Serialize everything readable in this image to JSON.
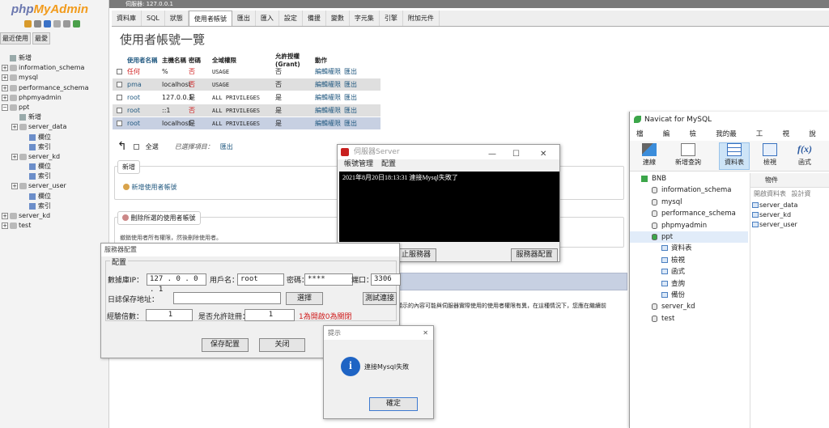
{
  "pma": {
    "logo_a": "php",
    "logo_b": "MyAdmin",
    "nav_tabs": [
      "最近使用",
      "最愛"
    ],
    "tree": [
      {
        "label": "新增",
        "level": 0,
        "kind": "new"
      },
      {
        "label": "information_schema",
        "level": 0,
        "kind": "db"
      },
      {
        "label": "mysql",
        "level": 0,
        "kind": "db"
      },
      {
        "label": "performance_schema",
        "level": 0,
        "kind": "db"
      },
      {
        "label": "phpmyadmin",
        "level": 0,
        "kind": "db"
      },
      {
        "label": "ppt",
        "level": 0,
        "kind": "db-open"
      },
      {
        "label": "新增",
        "level": 1,
        "kind": "new"
      },
      {
        "label": "server_data",
        "level": 1,
        "kind": "table"
      },
      {
        "label": "欄位",
        "level": 2,
        "kind": "sub"
      },
      {
        "label": "索引",
        "level": 2,
        "kind": "sub"
      },
      {
        "label": "server_kd",
        "level": 1,
        "kind": "table"
      },
      {
        "label": "欄位",
        "level": 2,
        "kind": "sub"
      },
      {
        "label": "索引",
        "level": 2,
        "kind": "sub"
      },
      {
        "label": "server_user",
        "level": 1,
        "kind": "table"
      },
      {
        "label": "欄位",
        "level": 2,
        "kind": "sub"
      },
      {
        "label": "索引",
        "level": 2,
        "kind": "sub"
      },
      {
        "label": "server_kd",
        "level": 0,
        "kind": "db"
      },
      {
        "label": "test",
        "level": 0,
        "kind": "db"
      }
    ],
    "top_bar": "伺服器: 127.0.0.1",
    "tabs": [
      "資料庫",
      "SQL",
      "狀態",
      "使用者帳號",
      "匯出",
      "匯入",
      "設定",
      "備援",
      "變數",
      "字元集",
      "引擎",
      "附加元件"
    ],
    "active_tab": 3,
    "page_title": "使用者帳號一覽",
    "table_headers": [
      "使用者名稱",
      "主機名稱",
      "密碼",
      "全域權限",
      "允許授權(Grant)",
      "動作"
    ],
    "rows": [
      {
        "user": "任何",
        "host": "%",
        "pw": "否",
        "priv": "USAGE",
        "grant": "否",
        "edit": "編輯權限",
        "export": "匯出"
      },
      {
        "user": "pma",
        "host": "localhost",
        "pw": "否",
        "priv": "USAGE",
        "grant": "否",
        "edit": "編輯權限",
        "export": "匯出"
      },
      {
        "user": "root",
        "host": "127.0.0.1",
        "pw": "是",
        "priv": "ALL PRIVILEGES",
        "grant": "是",
        "edit": "編輯權限",
        "export": "匯出"
      },
      {
        "user": "root",
        "host": "::1",
        "pw": "否",
        "priv": "ALL PRIVILEGES",
        "grant": "是",
        "edit": "編輯權限",
        "export": "匯出"
      },
      {
        "user": "root",
        "host": "localhost",
        "pw": "是",
        "priv": "ALL PRIVILEGES",
        "grant": "是",
        "edit": "編輯權限",
        "export": "匯出"
      }
    ],
    "check_all": "全選",
    "selected_label": "已選擇項目：",
    "selected_export": "匯出",
    "add_legend": "新增",
    "add_user_link": "新增使用者帳號",
    "remove_legend": "刪除所選的使用者帳號",
    "remove_note": "撤銷使用者所有權限，然後刪除使用者。",
    "warn_text": "顯示的內容可能與伺服器實際使用的使用者權限有異，在這種情況下，您應在繼續前"
  },
  "config_dialog": {
    "title": "服務器配置",
    "legend": "配置",
    "ip_label": "數據庫IP：",
    "ip_value": "127 . 0 . 0 . 1",
    "user_label": "用戶名：",
    "user_value": "root",
    "pw_label": "密碼：",
    "pw_value": "****",
    "port_label": "端口：",
    "port_value": "3306",
    "log_label": "日誌保存地址：",
    "log_value": "",
    "choose_btn": "選擇",
    "test_btn": "測試連接",
    "exp_label": "經驗倍數：",
    "exp_value": "1",
    "reg_label": "是否允許註冊：",
    "reg_value": "1",
    "reg_hint": "1為開啟0為關閉",
    "save_btn": "保存配置",
    "close_btn": "关闭"
  },
  "server_window": {
    "title": "伺服器Server",
    "menu": [
      "帳號管理",
      "配置"
    ],
    "console": "2021年8月20日18:13:31 連接Mysql失敗了",
    "stop_btn": "止服務器",
    "config_btn": "服務器配置"
  },
  "tip_dialog": {
    "title": "提示",
    "message": "連接Mysql失敗",
    "ok_btn": "確定"
  },
  "navicat": {
    "title": "Navicat for MySQL",
    "menu": [
      "檔案",
      "編輯",
      "檢視",
      "我的最愛",
      "工具",
      "視窗",
      "說明"
    ],
    "tools": [
      "連線",
      "新增查詢",
      "資料表",
      "檢視",
      "函式"
    ],
    "tree": [
      {
        "label": "BNB",
        "level": 0
      },
      {
        "label": "information_schema",
        "level": 1
      },
      {
        "label": "mysql",
        "level": 1
      },
      {
        "label": "performance_schema",
        "level": 1
      },
      {
        "label": "phpmyadmin",
        "level": 1
      },
      {
        "label": "ppt",
        "level": 1
      },
      {
        "label": "資料表",
        "level": 2
      },
      {
        "label": "檢視",
        "level": 2
      },
      {
        "label": "函式",
        "level": 2
      },
      {
        "label": "查詢",
        "level": 2
      },
      {
        "label": "備份",
        "level": 2
      },
      {
        "label": "server_kd",
        "level": 1
      },
      {
        "label": "test",
        "level": 1
      }
    ],
    "objects_tab": "物件",
    "open_table": "開啟資料表",
    "design_table": "設計資",
    "objects": [
      "server_data",
      "server_kd",
      "server_user"
    ]
  }
}
